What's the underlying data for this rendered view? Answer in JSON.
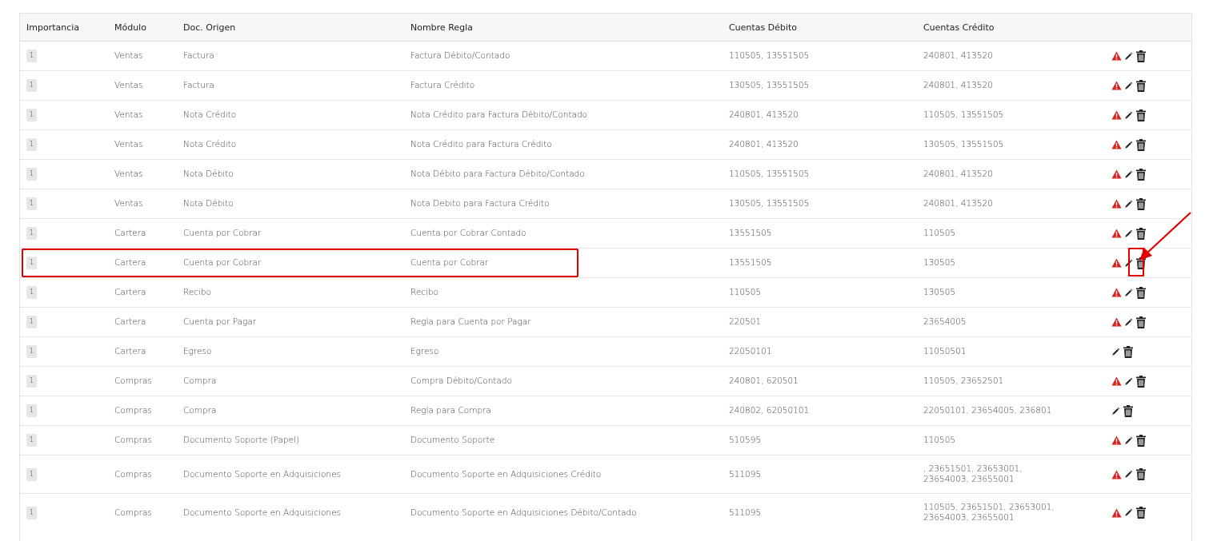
{
  "table": {
    "headers": [
      "Importancia",
      "Módulo",
      "Doc. Origen",
      "Nombre Regla",
      "Cuentas Débito",
      "Cuentas Crédito",
      ""
    ],
    "rows": [
      {
        "importance": "1",
        "module": "Ventas",
        "doc": "Factura",
        "rule": "Factura Débito/Contado",
        "debit": "110505, 13551505",
        "credit": "240801, 413520",
        "warn": true
      },
      {
        "importance": "1",
        "module": "Ventas",
        "doc": "Factura",
        "rule": "Factura Crédito",
        "debit": "130505, 13551505",
        "credit": "240801, 413520",
        "warn": true
      },
      {
        "importance": "1",
        "module": "Ventas",
        "doc": "Nota Crédito",
        "rule": "Nota Crédito para Factura Débito/Contado",
        "debit": "240801, 413520",
        "credit": "110505, 13551505",
        "warn": true
      },
      {
        "importance": "1",
        "module": "Ventas",
        "doc": "Nota Crédito",
        "rule": "Nota Crédito para Factura Crédito",
        "debit": "240801, 413520",
        "credit": "130505, 13551505",
        "warn": true
      },
      {
        "importance": "1",
        "module": "Ventas",
        "doc": "Nota Débito",
        "rule": "Nota Débito para Factura Débito/Contado",
        "debit": "110505, 13551505",
        "credit": "240801, 413520",
        "warn": true
      },
      {
        "importance": "1",
        "module": "Ventas",
        "doc": "Nota Débito",
        "rule": "Nota Debito para Factura Crédito",
        "debit": "130505, 13551505",
        "credit": "240801, 413520",
        "warn": true
      },
      {
        "importance": "1",
        "module": "Cartera",
        "doc": "Cuenta por Cobrar",
        "rule": "Cuenta por Cobrar Contado",
        "debit": "13551505",
        "credit": "110505",
        "warn": true
      },
      {
        "importance": "1",
        "module": "Cartera",
        "doc": "Cuenta por Cobrar",
        "rule": "Cuenta por Cobrar",
        "debit": "13551505",
        "credit": "130505",
        "warn": true
      },
      {
        "importance": "1",
        "module": "Cartera",
        "doc": "Recibo",
        "rule": "Recibo",
        "debit": "110505",
        "credit": "130505",
        "warn": true
      },
      {
        "importance": "1",
        "module": "Cartera",
        "doc": "Cuenta por Pagar",
        "rule": "Regla para Cuenta por Pagar",
        "debit": "220501",
        "credit": "23654005",
        "warn": true
      },
      {
        "importance": "1",
        "module": "Cartera",
        "doc": "Egreso",
        "rule": "Egreso",
        "debit": "22050101",
        "credit": "11050501",
        "warn": false
      },
      {
        "importance": "1",
        "module": "Compras",
        "doc": "Compra",
        "rule": "Compra Débito/Contado",
        "debit": "240801, 620501",
        "credit": "110505, 23652501",
        "warn": true
      },
      {
        "importance": "1",
        "module": "Compras",
        "doc": "Compra",
        "rule": "Regla para Compra",
        "debit": "240802, 62050101",
        "credit": "22050101, 23654005, 236801",
        "warn": false
      },
      {
        "importance": "1",
        "module": "Compras",
        "doc": "Documento Soporte (Papel)",
        "rule": "Documento Soporte",
        "debit": "510595",
        "credit": "110505",
        "warn": true
      },
      {
        "importance": "1",
        "module": "Compras",
        "doc": "Documento Soporte en Adquisiciones",
        "rule": "Documento Soporte en Adquisiciones Crédito",
        "debit": "511095",
        "credit_line1": ", 23651501, 23653001,",
        "credit_line2": "23654003, 23655001",
        "warn": true
      },
      {
        "importance": "1",
        "module": "Compras",
        "doc": "Documento Soporte en Adquisiciones",
        "rule": "Documento Soporte en Adquisiciones Débito/Contado",
        "debit": "511095",
        "credit_line1": "110505, 23651501, 23653001,",
        "credit_line2": "23654003, 23655001",
        "warn": true
      }
    ]
  },
  "icons": {
    "warn": "warning-icon",
    "edit": "pencil-icon",
    "delete": "trash-icon"
  },
  "colors": {
    "warn": "#d9201a",
    "highlight": "#e00000"
  }
}
